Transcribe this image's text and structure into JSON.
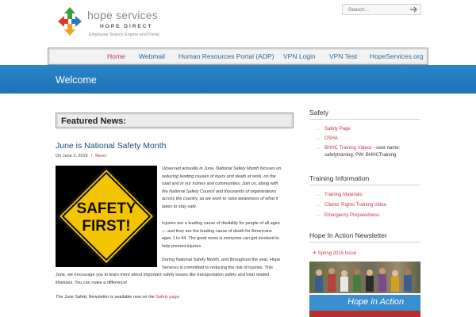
{
  "header": {
    "logo_name": "hope services",
    "logo_sub": "HOPE DIRECT",
    "logo_tagline": "Employee Search Engine and Portal",
    "search_placeholder": "Search..."
  },
  "nav": {
    "items": [
      {
        "label": "Home",
        "active": true
      },
      {
        "label": "Webmail"
      },
      {
        "label": "Human Resources Portal (ADP)"
      },
      {
        "label": "VPN Login"
      },
      {
        "label": "VPN Test"
      },
      {
        "label": "HopeServices.org"
      }
    ]
  },
  "banner": {
    "title": "Welcome"
  },
  "main": {
    "featured_title": "Featured News:",
    "post": {
      "title": "June is National Safety Month",
      "date": "On June 2, 2015",
      "category": "News",
      "image_text_1": "SAFETY",
      "image_text_2": "FIRST!",
      "para1_lines": [
        "Observed annually in June, National Safety Month focuses on",
        "reducing leading causes of injury and death at work, on the",
        "road and in our homes and communities.  Join us, along with",
        "the National Safety Council and thousands of organizations",
        "across the country, as we work to raise awareness of what it",
        "takes to stay safe."
      ],
      "para2_lines": [
        "Injuries are a leading cause of disability for people of all ages",
        "— and they are the leading cause of death for Americans",
        "ages 1 to 44. The good news is everyone can get involved to",
        "help prevent injuries."
      ],
      "para3_lines": [
        "During National Safety Month, and throughout the year, Hope",
        "Services is committed to reducing the risk of injuries. This",
        "June, we encourage you to learn more about important safety issues like transportation safety and heat related",
        "illnesses. You can make a difference!"
      ],
      "newsletter_note": "The June Safety Newsletter is available now on the",
      "newsletter_link": "Safety page",
      "newsletter_end": "."
    }
  },
  "sidebar": {
    "safety": {
      "heading": "Safety",
      "items": [
        {
          "label": "Safety Page"
        },
        {
          "label": "OSHA"
        },
        {
          "label": "BHHC Training Videos",
          "rest": " - user name:",
          "line2": "safetytraining, PW: BHHCTraining"
        }
      ]
    },
    "training": {
      "heading": "Training Information",
      "items": [
        {
          "label": "Training Materials"
        },
        {
          "label": "Clients' Rights Training Video"
        },
        {
          "label": "Emergency Preparedness"
        }
      ]
    },
    "newsletter": {
      "heading": "Hope In Action Newsletter",
      "issue": "Spring 2015 Issue",
      "cover_title": "Hope in Action"
    }
  },
  "colors": {
    "accent_red": "#c8324a",
    "link_blue": "#2d6b9b",
    "banner_blue": "#1f78b9"
  }
}
